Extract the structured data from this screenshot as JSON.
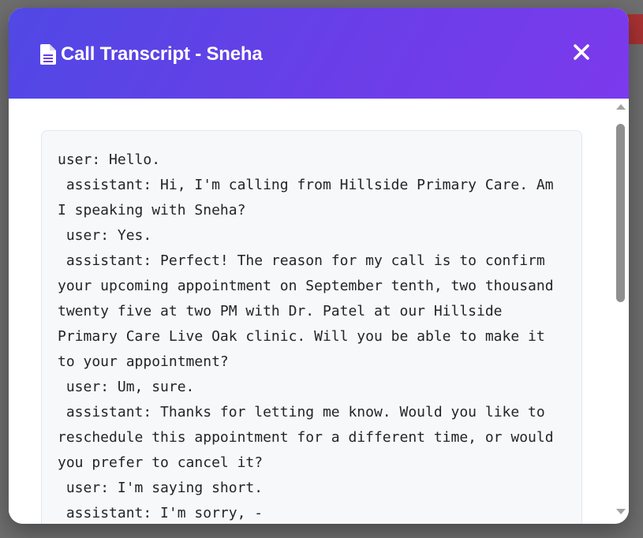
{
  "modal": {
    "title": "Call Transcript - Sneha",
    "title_icon": "file-document-icon",
    "close_icon": "close-x-icon"
  },
  "transcript": {
    "text": "user: Hello.\n assistant: Hi, I'm calling from Hillside Primary Care. Am I speaking with Sneha?\n user: Yes.\n assistant: Perfect! The reason for my call is to confirm your upcoming appointment on September tenth, two thousand twenty five at two PM with Dr. Patel at our Hillside Primary Care Live Oak clinic. Will you be able to make it to your appointment?\n user: Um, sure.\n assistant: Thanks for letting me know. Would you like to reschedule this appointment for a different time, or would you prefer to cancel it?\n user: I'm saying short.\n assistant: I'm sorry, -"
  },
  "colors": {
    "header_gradient_start": "#5048e5",
    "header_gradient_end": "#7c3aed",
    "transcript_background": "#f7f8fa",
    "text": "#212529"
  }
}
